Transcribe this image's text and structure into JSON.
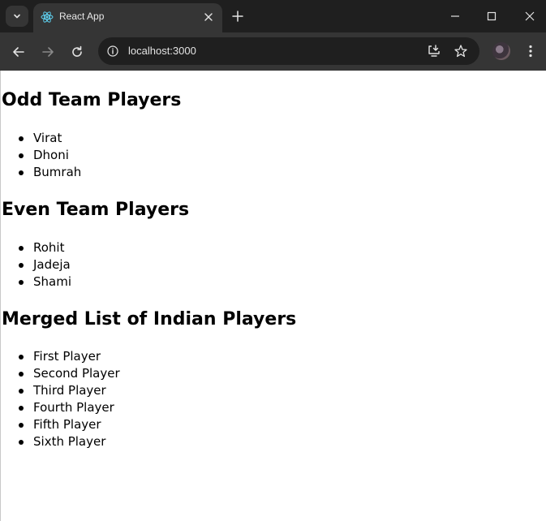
{
  "browser": {
    "tab_title": "React App",
    "url": "localhost:3000"
  },
  "page": {
    "odd": {
      "heading": "Odd Team Players",
      "players": [
        "Virat",
        "Dhoni",
        "Bumrah"
      ]
    },
    "even": {
      "heading": "Even Team Players",
      "players": [
        "Rohit",
        "Jadeja",
        "Shami"
      ]
    },
    "merged": {
      "heading": "Merged List of Indian Players",
      "players": [
        "First Player",
        "Second Player",
        "Third Player",
        "Fourth Player",
        "Fifth Player",
        "Sixth Player"
      ]
    }
  }
}
